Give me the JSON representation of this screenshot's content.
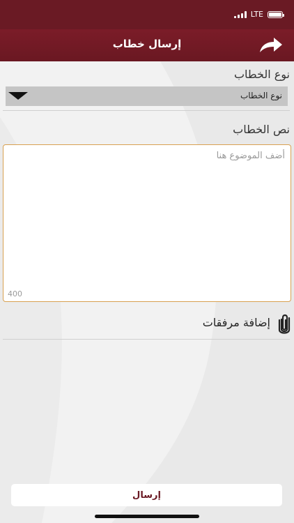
{
  "status_bar": {
    "network": "LTE"
  },
  "nav": {
    "title": "إرسال خطاب",
    "back_icon": "share-forward-arrow-icon"
  },
  "form": {
    "type_label": "نوع الخطاب",
    "type_select": {
      "selected": "نوع الخطاب"
    },
    "body_label": "نص الخطاب",
    "body_input": {
      "placeholder": "أضف الموضوع هنا",
      "value": "",
      "counter": "400"
    },
    "attach": {
      "label": "إضافة مرفقات",
      "icon": "paperclip-icon"
    }
  },
  "actions": {
    "send_label": "إرسال"
  },
  "colors": {
    "header": "#6a1822",
    "input_border": "#d8a050",
    "send_text": "#6a1822"
  }
}
